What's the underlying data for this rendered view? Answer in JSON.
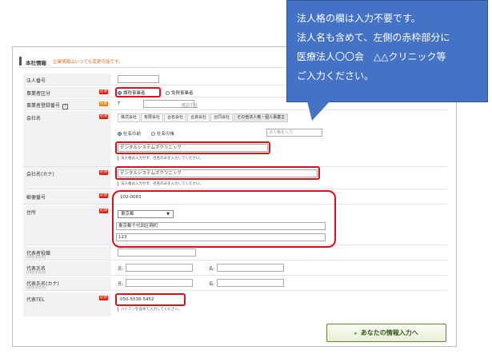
{
  "panel": {
    "title": "本社情報",
    "note": "企業情報はいつでも変更可能です。"
  },
  "badges": {
    "required": "必須",
    "optional": "任意"
  },
  "rows": {
    "houjin_bangou": {
      "label": "法人番号",
      "value": ""
    },
    "jigyousha_kubun": {
      "label": "事業者区分",
      "options": [
        "課税事業者",
        "免税事業者"
      ],
      "selected": "課税事業者"
    },
    "touroku_bangou": {
      "label": "事業者登録番号",
      "help": "?",
      "prefix": "T",
      "value": "",
      "link": "確認する"
    },
    "kaisha_mei": {
      "label": "会社名",
      "tabs": [
        "株式会社",
        "有限会社",
        "合名会社",
        "合資会社",
        "合同会社",
        "その他法人格・個人事業主"
      ],
      "position_options": [
        "社名の前",
        "社名の後"
      ],
      "position_selected": "社名の前",
      "houjinkaku_placeholder": "法人格を入力",
      "value": "デンタルシステムズクリニック",
      "hint": "法人格は入力せず、社名のみを入力してください。"
    },
    "kaisha_mei_kana": {
      "label": "会社名(カナ)",
      "value": "デンタルシステムズクリニック",
      "hint": "法人格は入力せず、社名のみを入力してください。"
    },
    "yuubin": {
      "label": "郵便番号",
      "value": "102-0083"
    },
    "juusho": {
      "label": "住所",
      "prefecture": "東京都",
      "city": "東京都千代田区麹町",
      "street": "123"
    },
    "daihyou_yakushoku": {
      "label": "代表者役職",
      "sub": "(20文字以内)",
      "value": ""
    },
    "daihyou_shimei": {
      "label": "代表氏名",
      "sub": "(20文字以内)",
      "sei_label": "氏:",
      "mei_label": "名:"
    },
    "daihyou_shimei_kana": {
      "label": "代表氏名(カナ)",
      "sub": "(20文字以内)",
      "sei_label": "氏:",
      "mei_label": "名:"
    },
    "daihyou_tel": {
      "label": "代表TEL",
      "value": "050-5536-5452",
      "hint": "ハイフンを含めて入力してください。"
    }
  },
  "next_button": {
    "arrow": "▸",
    "label": "あなたの情報入力へ"
  },
  "callout": {
    "lines": [
      "法人格の欄は入力不要です。",
      "法人名も含めて、左側の赤枠部分に",
      "医療法人〇〇会　△△クリニック等",
      "ご入力ください。"
    ]
  },
  "colors": {
    "highlight": "#e0101a",
    "callout": "#4472c4",
    "required": "#d9230f"
  }
}
